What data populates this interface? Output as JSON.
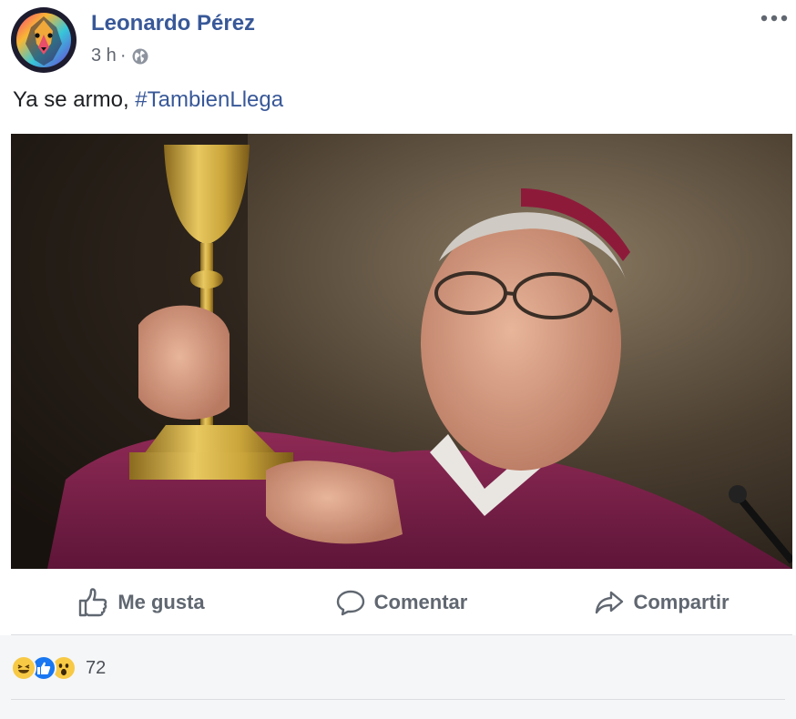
{
  "post": {
    "author": "Leonardo Pérez",
    "timestamp": "3 h",
    "separator": "·",
    "privacy_icon": "globe-icon",
    "text_prefix": "Ya se armo, ",
    "hashtag": "#TambienLlega",
    "photo_icon": "photo-image"
  },
  "actions": {
    "like_label": "Me gusta",
    "comment_label": "Comentar",
    "share_label": "Compartir"
  },
  "reactions": {
    "types": [
      "haha",
      "like",
      "wow"
    ],
    "count": "72"
  },
  "colors": {
    "link": "#385898",
    "text": "#1c1e21",
    "muted": "#616770",
    "action": "#606770",
    "like_blue": "#1877f2",
    "emoji_yellow": "#f7c945",
    "footer_bg": "#f5f6f7"
  }
}
